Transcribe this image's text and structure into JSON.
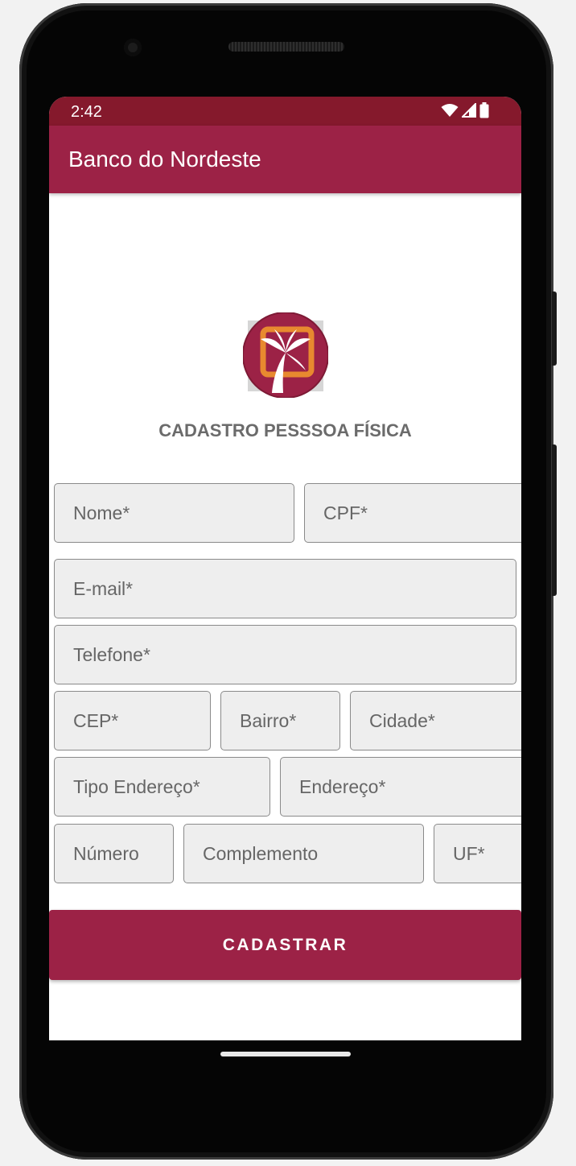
{
  "status_bar": {
    "time": "2:42",
    "icons": [
      "wifi-icon",
      "cell-signal-icon",
      "battery-icon"
    ]
  },
  "app_bar": {
    "title": "Banco do Nordeste"
  },
  "form": {
    "title": "CADASTRO PESSSOA FÍSICA",
    "fields": {
      "nome": "Nome*",
      "cpf": "CPF*",
      "email": "E-mail*",
      "telefone": "Telefone*",
      "cep": "CEP*",
      "bairro": "Bairro*",
      "cidade": "Cidade*",
      "tipo_endereco": "Tipo Endereço*",
      "endereco": "Endereço*",
      "numero": "Número",
      "complemento": "Complemento",
      "uf": "UF*"
    },
    "submit_label": "CADASTRAR"
  },
  "colors": {
    "status_bar": "#85192c",
    "app_bar": "#9c2246",
    "button": "#9c2246",
    "logo_orange": "#e8892f"
  }
}
